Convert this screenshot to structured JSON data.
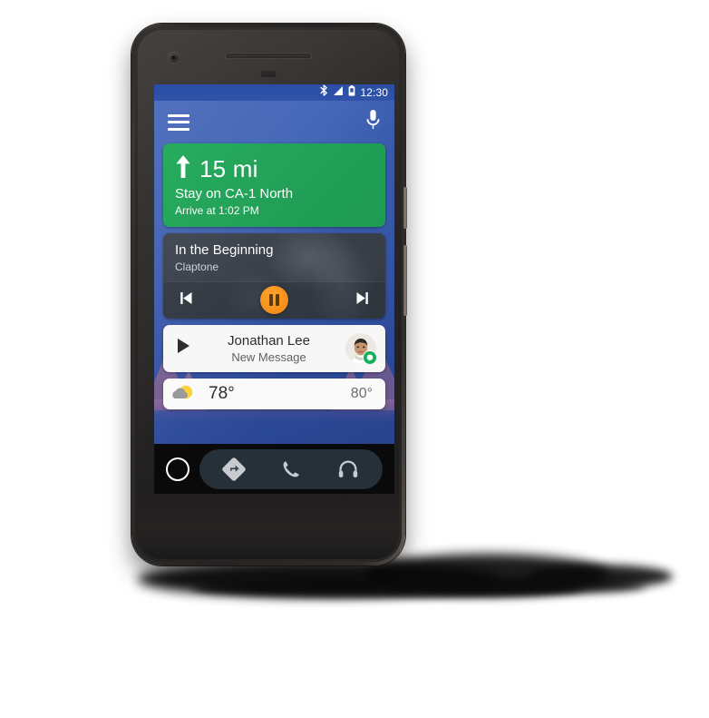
{
  "device": {
    "name": "android-smartphone",
    "hardware": {
      "front_camera": "camera-icon",
      "earpiece": "speaker-grille",
      "proximity_sensor": "sensor",
      "power_button": "power-button",
      "volume_button": "volume-rocker"
    }
  },
  "screen": {
    "status_bar": {
      "bluetooth_icon": "bluetooth-icon",
      "signal_icon": "signal-icon",
      "battery_icon": "battery-icon",
      "time": "12:30"
    },
    "app_bar": {
      "menu_icon": "hamburger-menu-icon",
      "mic_icon": "microphone-icon"
    },
    "cards": {
      "navigation": {
        "direction_icon": "arrow-up-icon",
        "distance": "15 mi",
        "instruction": "Stay on CA-1 North",
        "eta": "Arrive at 1:02 PM",
        "color": "#22a057"
      },
      "media": {
        "title": "In the Beginning",
        "artist": "Claptone",
        "prev_icon": "skip-previous-icon",
        "play_pause_icon": "pause-icon",
        "next_icon": "skip-next-icon",
        "accent_color": "#f7921e",
        "background_color": "#3b424c"
      },
      "message": {
        "play_icon": "play-triangle-icon",
        "sender": "Jonathan Lee",
        "subtitle": "New Message",
        "avatar": "contact-avatar",
        "app_badge": "hangouts-badge-icon",
        "badge_color": "#12b05a"
      },
      "weather": {
        "condition_icon": "partly-cloudy-icon",
        "temperature": "78°",
        "high_temperature": "80°"
      }
    },
    "bottom_nav": {
      "home_icon": "home-circle-icon",
      "items": [
        {
          "icon": "navigation-diamond-icon",
          "label": "navigation",
          "selected": true
        },
        {
          "icon": "phone-icon",
          "label": "phone",
          "selected": false
        },
        {
          "icon": "headphones-icon",
          "label": "media",
          "selected": false
        }
      ],
      "pill_color": "#253039"
    }
  }
}
